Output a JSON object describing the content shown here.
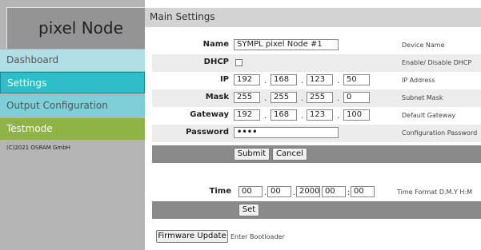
{
  "sidebar": {
    "logo": "pixel Node",
    "items": [
      {
        "label": "Dashboard"
      },
      {
        "label": "Settings"
      },
      {
        "label": "Output Configuration"
      },
      {
        "label": "Testmode"
      }
    ],
    "copyright": "(C)2021 OSRAM GmbH"
  },
  "header": {
    "title": "Main Settings"
  },
  "form": {
    "name": {
      "label": "Name",
      "value": "SYMPL pixel Node #1",
      "desc": "Device Name"
    },
    "dhcp": {
      "label": "DHCP",
      "checked": false,
      "desc": "Enable/ Disable DHCP"
    },
    "ip": {
      "label": "IP",
      "values": [
        "192",
        "168",
        "123",
        "50"
      ],
      "desc": "IP Address"
    },
    "mask": {
      "label": "Mask",
      "values": [
        "255",
        "255",
        "255",
        "0"
      ],
      "desc": "Subnet Mask"
    },
    "gateway": {
      "label": "Gateway",
      "values": [
        "192",
        "168",
        "123",
        "100"
      ],
      "desc": "Default Gateway"
    },
    "password": {
      "label": "Password",
      "value": "••••",
      "desc": "Configuration Password"
    },
    "submit_label": "Submit",
    "cancel_label": "Cancel",
    "separator": "."
  },
  "time": {
    "label": "Time",
    "day": "00",
    "month": "00",
    "year": "2000",
    "hour": "00",
    "minute": "00",
    "date_sep": ".",
    "time_sep": ":",
    "desc": "Time Format D.M.Y H:M",
    "set_label": "Set"
  },
  "firmware": {
    "button_label": "Firmware Update",
    "note": "Enter Bootloader"
  }
}
